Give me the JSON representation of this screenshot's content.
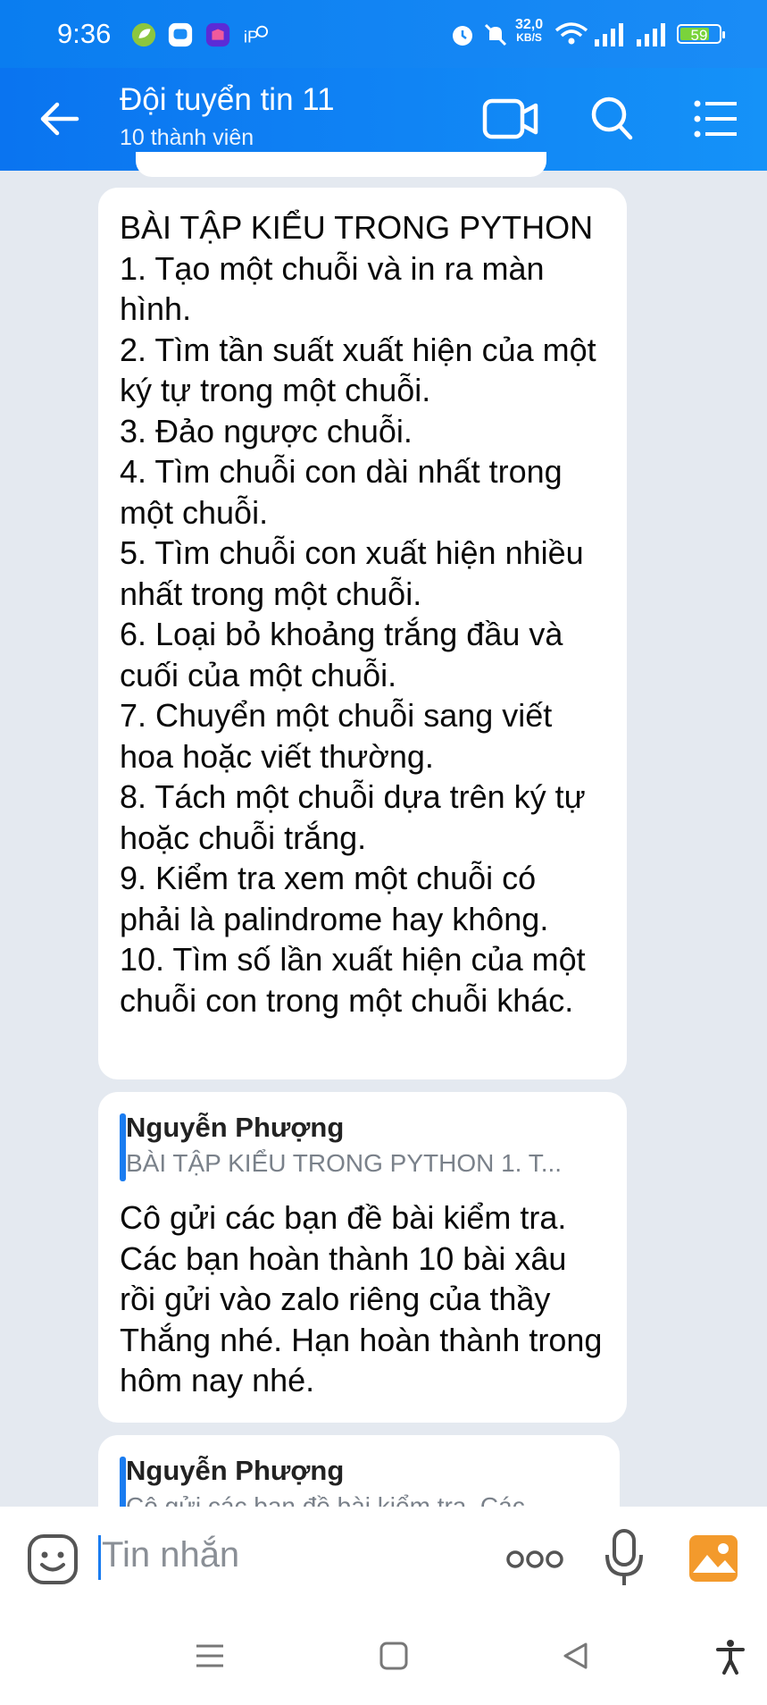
{
  "status_bar": {
    "time": "9:36",
    "net_speed_value": "32,0",
    "net_speed_unit": "KB/S",
    "battery": "59",
    "icons": [
      "leaf-app-icon",
      "chat-app-icon",
      "lazada-app-icon",
      "ip-icon",
      "alarm-icon",
      "mute-icon",
      "wifi-icon",
      "signal-icon",
      "signal-icon",
      "battery-icon"
    ]
  },
  "header": {
    "title": "Đội tuyển tin 11",
    "subtitle": "10 thành viên",
    "icons": [
      "back-arrow-icon",
      "video-call-icon",
      "search-icon",
      "menu-list-icon"
    ]
  },
  "messages": [
    {
      "text": "BÀI TẬP KIỂU TRONG PYTHON\n1.  Tạo một chuỗi và in ra màn hình.\n2.  Tìm tần suất xuất hiện của một ký tự trong một chuỗi.\n3.  Đảo ngược chuỗi.\n4.  Tìm chuỗi con dài nhất trong một chuỗi.\n5.  Tìm chuỗi con xuất hiện nhiều nhất trong một chuỗi.\n6.  Loại bỏ khoảng trắng đầu và cuối của một chuỗi.\n7.  Chuyển một chuỗi sang viết hoa hoặc viết thường.\n8.  Tách một chuỗi dựa trên ký tự hoặc chuỗi trắng.\n9.  Kiểm tra xem một chuỗi có phải là palindrome hay không.\n10.  Tìm số lần xuất hiện của một chuỗi con trong một chuỗi khác."
    },
    {
      "quote_author": "Nguyễn Phượng",
      "quote_text": "BÀI TẬP KIỂU TRONG PYTHON 1.  T...",
      "text": "Cô gửi các bạn đề bài kiểm tra. Các bạn hoàn thành 10 bài xâu rồi gửi vào zalo riêng của thầy Thắng nhé. Hạn hoàn thành trong hôm nay nhé."
    },
    {
      "quote_author": "Nguyễn Phượng",
      "quote_text": "Cô gửi các bạn đề bài kiểm tra. Các"
    }
  ],
  "input": {
    "placeholder": "Tin nhắn",
    "icons": [
      "sticker-icon",
      "more-icon",
      "microphone-icon",
      "image-icon"
    ]
  },
  "navigation": {
    "icons": [
      "recent-apps-icon",
      "home-icon",
      "back-icon",
      "accessibility-icon"
    ]
  },
  "colors": {
    "header": "#0a7df0",
    "quote_bar": "#1a7cf0",
    "background": "#e4e9f0",
    "image_button": "#f39a2c"
  }
}
